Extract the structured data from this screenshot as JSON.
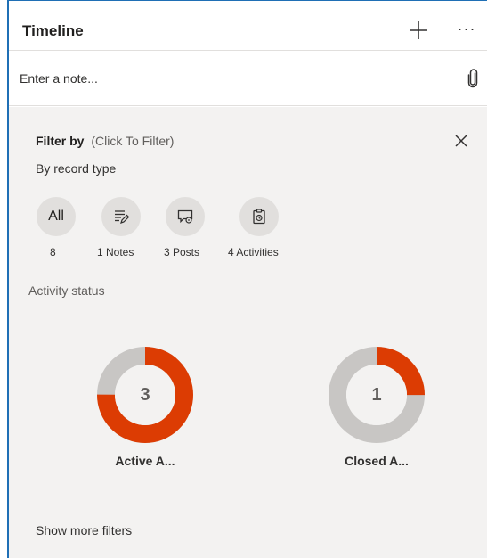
{
  "header": {
    "title": "Timeline",
    "add_icon": "plus-icon",
    "more_label": "···"
  },
  "note": {
    "placeholder": "Enter a note...",
    "attach_icon": "paperclip-icon"
  },
  "filter": {
    "label": "Filter by",
    "hint": "(Click To Filter)",
    "close_icon": "close-icon",
    "record_type_label": "By record type",
    "record_types": [
      {
        "id": "all",
        "icon_text": "All",
        "count_label": "8"
      },
      {
        "id": "notes",
        "icon": "note-edit-icon",
        "count_label": "1 Notes"
      },
      {
        "id": "posts",
        "icon": "post-icon",
        "count_label": "3 Posts"
      },
      {
        "id": "activities",
        "icon": "clipboard-activity-icon",
        "count_label": "4 Activities"
      }
    ],
    "activity_status_label": "Activity status",
    "activity_status": [
      {
        "id": "active",
        "count": "3",
        "label": "Active A...",
        "fraction": 0.75
      },
      {
        "id": "closed",
        "count": "1",
        "label": "Closed A...",
        "fraction": 0.25
      }
    ],
    "show_more_label": "Show more filters"
  },
  "colors": {
    "accent_orange": "#dc3c03",
    "donut_track": "#c8c6c4",
    "frame_blue": "#1f6fb5",
    "panel_background": "#f3f2f1"
  }
}
